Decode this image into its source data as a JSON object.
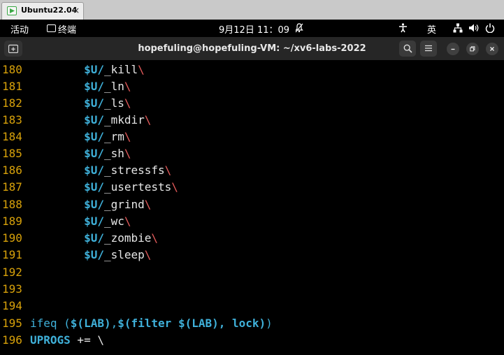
{
  "vm_tab": {
    "label": "Ubuntu22.04",
    "close": "×"
  },
  "topbar": {
    "activities": "活动",
    "ime_label": "终端",
    "clock": "9月12日  11：09",
    "lang": "英"
  },
  "terminal": {
    "title": "hopefuling@hopefuling-VM: ~/xv6-labs-2022",
    "lines": [
      {
        "num": "180",
        "indent": "        ",
        "var": "$U/",
        "name": "_kill",
        "bs": "\\"
      },
      {
        "num": "181",
        "indent": "        ",
        "var": "$U/",
        "name": "_ln",
        "bs": "\\"
      },
      {
        "num": "182",
        "indent": "        ",
        "var": "$U/",
        "name": "_ls",
        "bs": "\\"
      },
      {
        "num": "183",
        "indent": "        ",
        "var": "$U/",
        "name": "_mkdir",
        "bs": "\\"
      },
      {
        "num": "184",
        "indent": "        ",
        "var": "$U/",
        "name": "_rm",
        "bs": "\\"
      },
      {
        "num": "185",
        "indent": "        ",
        "var": "$U/",
        "name": "_sh",
        "bs": "\\"
      },
      {
        "num": "186",
        "indent": "        ",
        "var": "$U/",
        "name": "_stressfs",
        "bs": "\\"
      },
      {
        "num": "187",
        "indent": "        ",
        "var": "$U/",
        "name": "_usertests",
        "bs": "\\"
      },
      {
        "num": "188",
        "indent": "        ",
        "var": "$U/",
        "name": "_grind",
        "bs": "\\"
      },
      {
        "num": "189",
        "indent": "        ",
        "var": "$U/",
        "name": "_wc",
        "bs": "\\"
      },
      {
        "num": "190",
        "indent": "        ",
        "var": "$U/",
        "name": "_zombie",
        "bs": "\\"
      },
      {
        "num": "191",
        "indent": "        ",
        "var": "$U/",
        "name": "_sleep",
        "bs": "\\"
      },
      {
        "num": "192",
        "indent": "",
        "var": "",
        "name": "",
        "bs": ""
      },
      {
        "num": "193",
        "indent": "",
        "var": "",
        "name": "",
        "bs": ""
      },
      {
        "num": "194",
        "indent": "",
        "var": "",
        "name": "",
        "bs": ""
      }
    ],
    "line195": {
      "num": "195",
      "p1": "ifeq (",
      "v1": "$(LAB)",
      "p2": ",",
      "v2": "$(filter ",
      "v3": "$(LAB)",
      "v4": ", lock)",
      "p3": ")"
    },
    "line196": {
      "num": "196",
      "var": "UPROGS",
      "rest": " += ",
      "bs": "\\"
    }
  },
  "colors": {
    "line_number": "#d7a10a",
    "variable": "#3fb0d9",
    "backslash": "#e35a5a",
    "text": "#e6e6e6"
  }
}
